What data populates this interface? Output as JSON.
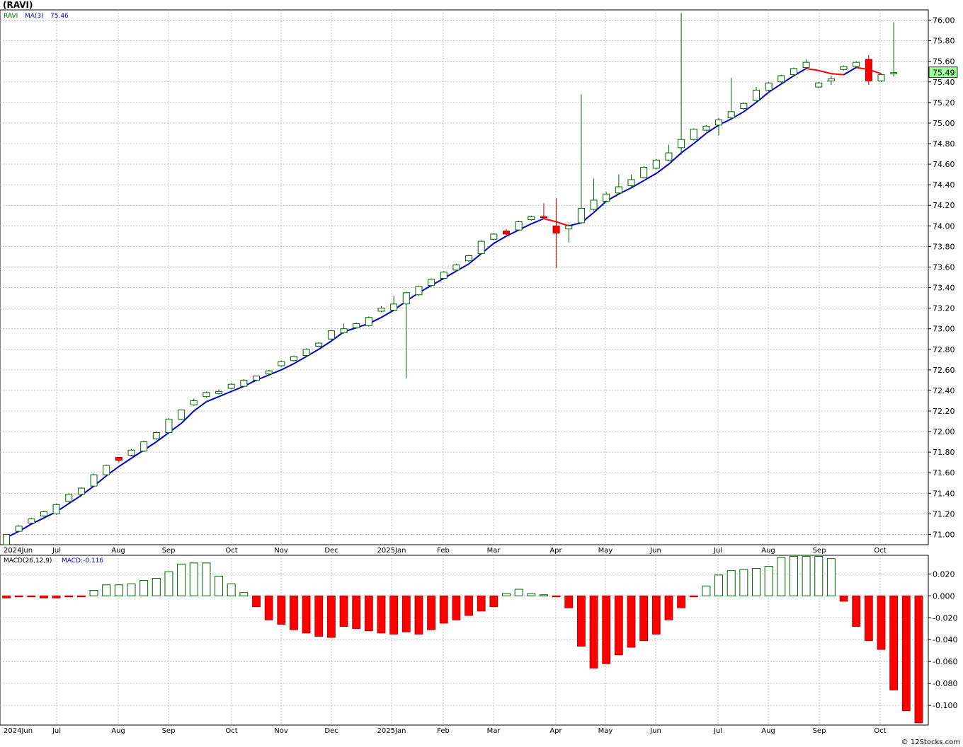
{
  "title": "(RAVI)",
  "credit": "© 12Stocks.com",
  "colors": {
    "up_candle_stroke": "#006400",
    "up_candle_fill": "#ffffff",
    "down_candle": "#ff0000",
    "ma_up": "#0000cc",
    "ma_down": "#ff0000",
    "macd_pos_stroke": "#006400",
    "macd_neg_fill": "#ff0000",
    "grid": "#b4b4b4",
    "last_price_bg": "#9bff9b"
  },
  "price_panel": {
    "legend_ticker": "RAVI",
    "legend_ma": "MA(3)",
    "legend_ma_value": "75.46",
    "last_price_label": "75.49",
    "ylim": [
      70.9,
      76.1
    ],
    "yticks": [
      "71.00",
      "71.20",
      "71.40",
      "71.60",
      "71.80",
      "72.00",
      "72.20",
      "72.40",
      "72.60",
      "72.80",
      "73.00",
      "73.20",
      "73.40",
      "73.60",
      "73.80",
      "74.00",
      "74.20",
      "74.40",
      "74.60",
      "74.80",
      "75.00",
      "75.20",
      "75.40",
      "75.60",
      "75.80",
      "76.00"
    ]
  },
  "macd_panel": {
    "legend_name": "MACD(26,12,9)",
    "legend_value": "MACD:-0.116",
    "ylim": [
      -0.118,
      0.037
    ],
    "yticks": [
      "0.020",
      "0.000",
      "-0.020",
      "-0.040",
      "-0.060",
      "-0.080",
      "-0.100"
    ]
  },
  "x_axis_labels": [
    "2024Jun",
    "Jul",
    "Aug",
    "Sep",
    "Oct",
    "Nov",
    "Dec",
    "2025Jan",
    "Feb",
    "Mar",
    "Apr",
    "May",
    "Jun",
    "Jul",
    "Aug",
    "Sep",
    "Oct"
  ],
  "chart_data": {
    "type": "candlestick",
    "interval": "weekly",
    "categories": [
      "2024-06-01",
      "2024-06-08",
      "2024-06-15",
      "2024-06-22",
      "2024-06-29",
      "2024-07-06",
      "2024-07-13",
      "2024-07-20",
      "2024-07-27",
      "2024-08-03",
      "2024-08-10",
      "2024-08-17",
      "2024-08-24",
      "2024-08-31",
      "2024-09-07",
      "2024-09-14",
      "2024-09-21",
      "2024-09-28",
      "2024-10-05",
      "2024-10-12",
      "2024-10-19",
      "2024-10-26",
      "2024-11-02",
      "2024-11-09",
      "2024-11-16",
      "2024-11-23",
      "2024-11-30",
      "2024-12-07",
      "2024-12-14",
      "2024-12-21",
      "2024-12-28",
      "2025-01-04",
      "2025-01-11",
      "2025-01-18",
      "2025-01-25",
      "2025-02-01",
      "2025-02-08",
      "2025-02-15",
      "2025-02-22",
      "2025-03-01",
      "2025-03-08",
      "2025-03-15",
      "2025-03-22",
      "2025-03-29",
      "2025-04-05",
      "2025-04-12",
      "2025-04-19",
      "2025-04-26",
      "2025-05-03",
      "2025-05-10",
      "2025-05-17",
      "2025-05-24",
      "2025-05-31",
      "2025-06-07",
      "2025-06-14",
      "2025-06-21",
      "2025-06-28",
      "2025-07-05",
      "2025-07-12",
      "2025-07-19",
      "2025-07-26",
      "2025-08-02",
      "2025-08-09",
      "2025-08-16",
      "2025-08-23",
      "2025-08-30",
      "2025-09-06",
      "2025-09-13",
      "2025-09-20",
      "2025-09-27",
      "2025-10-04"
    ],
    "ohlc": [
      [
        70.9,
        71.0,
        70.9,
        71.0
      ],
      [
        71.03,
        71.09,
        71.02,
        71.08
      ],
      [
        71.11,
        71.16,
        71.1,
        71.15
      ],
      [
        71.18,
        71.23,
        71.17,
        71.22
      ],
      [
        71.2,
        71.3,
        71.19,
        71.29
      ],
      [
        71.32,
        71.4,
        71.31,
        71.39
      ],
      [
        71.39,
        71.46,
        71.38,
        71.45
      ],
      [
        71.47,
        71.59,
        71.46,
        71.58
      ],
      [
        71.58,
        71.68,
        71.57,
        71.67
      ],
      [
        71.75,
        71.75,
        71.7,
        71.72
      ],
      [
        71.77,
        71.83,
        71.76,
        71.82
      ],
      [
        71.81,
        71.91,
        71.8,
        71.9
      ],
      [
        71.93,
        72.0,
        71.92,
        71.99
      ],
      [
        71.99,
        72.13,
        71.98,
        72.12
      ],
      [
        72.12,
        72.2,
        72.11,
        72.21
      ],
      [
        72.26,
        72.32,
        72.25,
        72.3
      ],
      [
        72.34,
        72.39,
        72.33,
        72.38
      ],
      [
        72.37,
        72.41,
        72.36,
        72.39
      ],
      [
        72.42,
        72.47,
        72.41,
        72.46
      ],
      [
        72.44,
        72.51,
        72.43,
        72.5
      ],
      [
        72.5,
        72.54,
        72.49,
        72.54
      ],
      [
        72.56,
        72.6,
        72.55,
        72.59
      ],
      [
        72.64,
        72.69,
        72.63,
        72.68
      ],
      [
        72.69,
        72.74,
        72.68,
        72.73
      ],
      [
        72.74,
        72.81,
        72.73,
        72.8
      ],
      [
        72.83,
        72.87,
        72.82,
        72.86
      ],
      [
        72.9,
        72.99,
        72.89,
        72.98
      ],
      [
        72.96,
        73.05,
        72.95,
        73.0
      ],
      [
        73.01,
        73.06,
        73.0,
        73.05
      ],
      [
        73.03,
        73.12,
        73.02,
        73.11
      ],
      [
        73.17,
        73.22,
        73.16,
        73.2
      ],
      [
        73.18,
        73.32,
        73.17,
        73.24
      ],
      [
        73.24,
        73.36,
        72.52,
        73.35
      ],
      [
        73.33,
        73.42,
        73.32,
        73.41
      ],
      [
        73.42,
        73.49,
        73.41,
        73.48
      ],
      [
        73.49,
        73.56,
        73.48,
        73.55
      ],
      [
        73.57,
        73.63,
        73.56,
        73.62
      ],
      [
        73.66,
        73.72,
        73.65,
        73.71
      ],
      [
        73.73,
        73.86,
        73.72,
        73.85
      ],
      [
        73.87,
        73.93,
        73.86,
        73.92
      ],
      [
        73.95,
        73.97,
        73.91,
        73.92
      ],
      [
        73.96,
        74.05,
        73.95,
        74.04
      ],
      [
        74.06,
        74.1,
        74.05,
        74.09
      ],
      [
        74.09,
        74.22,
        74.08,
        74.08
      ],
      [
        74.0,
        74.27,
        73.59,
        73.93
      ],
      [
        73.97,
        74.02,
        73.84,
        74.0
      ],
      [
        74.03,
        75.28,
        74.02,
        74.17
      ],
      [
        74.16,
        74.46,
        74.15,
        74.25
      ],
      [
        74.24,
        74.33,
        74.23,
        74.31
      ],
      [
        74.32,
        74.5,
        74.31,
        74.38
      ],
      [
        74.39,
        74.5,
        74.38,
        74.45
      ],
      [
        74.47,
        74.58,
        74.46,
        74.57
      ],
      [
        74.56,
        74.65,
        74.55,
        74.64
      ],
      [
        74.64,
        74.79,
        74.63,
        74.71
      ],
      [
        74.76,
        76.07,
        74.69,
        74.84
      ],
      [
        74.84,
        74.95,
        74.83,
        74.94
      ],
      [
        74.93,
        74.98,
        74.92,
        74.97
      ],
      [
        74.98,
        75.05,
        74.88,
        75.03
      ],
      [
        75.05,
        75.44,
        75.04,
        75.11
      ],
      [
        75.14,
        75.2,
        75.13,
        75.19
      ],
      [
        75.22,
        75.35,
        75.21,
        75.32
      ],
      [
        75.32,
        75.4,
        75.31,
        75.39
      ],
      [
        75.4,
        75.47,
        75.39,
        75.46
      ],
      [
        75.47,
        75.54,
        75.46,
        75.53
      ],
      [
        75.54,
        75.62,
        75.53,
        75.59
      ],
      [
        75.35,
        75.4,
        75.34,
        75.39
      ],
      [
        75.41,
        75.46,
        75.37,
        75.43
      ],
      [
        75.52,
        75.56,
        75.51,
        75.55
      ],
      [
        75.55,
        75.6,
        75.54,
        75.59
      ],
      [
        75.62,
        75.66,
        75.37,
        75.41
      ],
      [
        75.41,
        75.48,
        75.4,
        75.47
      ],
      [
        75.49,
        75.98,
        75.45,
        75.49
      ]
    ],
    "ma3": [
      70.97,
      71.03,
      71.1,
      71.16,
      71.22,
      71.3,
      71.38,
      71.47,
      71.57,
      71.66,
      71.74,
      71.82,
      71.9,
      71.99,
      72.08,
      72.2,
      72.29,
      72.34,
      72.39,
      72.44,
      72.5,
      72.55,
      72.6,
      72.66,
      72.73,
      72.8,
      72.88,
      72.97,
      73.01,
      73.05,
      73.11,
      73.18,
      73.27,
      73.35,
      73.42,
      73.49,
      73.56,
      73.63,
      73.73,
      73.83,
      73.9,
      73.96,
      74.02,
      74.07,
      74.04,
      74.0,
      74.03,
      74.13,
      74.24,
      74.31,
      74.37,
      74.44,
      74.51,
      74.6,
      74.71,
      74.8,
      74.9,
      74.98,
      75.04,
      75.11,
      75.2,
      75.3,
      75.38,
      75.46,
      75.53,
      75.51,
      75.48,
      75.47,
      75.54,
      75.52,
      75.48
    ],
    "macd": [
      -0.002,
      -0.001,
      -0.001,
      -0.002,
      -0.002,
      -0.001,
      -0.001,
      0.005,
      0.01,
      0.01,
      0.011,
      0.014,
      0.016,
      0.022,
      0.029,
      0.03,
      0.03,
      0.018,
      0.011,
      0.003,
      -0.01,
      -0.022,
      -0.026,
      -0.031,
      -0.034,
      -0.037,
      -0.038,
      -0.028,
      -0.03,
      -0.032,
      -0.034,
      -0.035,
      -0.033,
      -0.035,
      -0.031,
      -0.025,
      -0.022,
      -0.018,
      -0.014,
      -0.01,
      0.002,
      0.006,
      0.002,
      0.001,
      -0.001,
      -0.011,
      -0.046,
      -0.066,
      -0.062,
      -0.054,
      -0.047,
      -0.041,
      -0.035,
      -0.022,
      -0.011,
      -0.001,
      0.009,
      0.019,
      0.023,
      0.024,
      0.025,
      0.027,
      0.035,
      0.036,
      0.036,
      0.036,
      0.034,
      -0.005,
      -0.028,
      -0.041,
      -0.049,
      -0.086,
      -0.105,
      -0.116
    ],
    "macd_x_index_offset": 0
  }
}
